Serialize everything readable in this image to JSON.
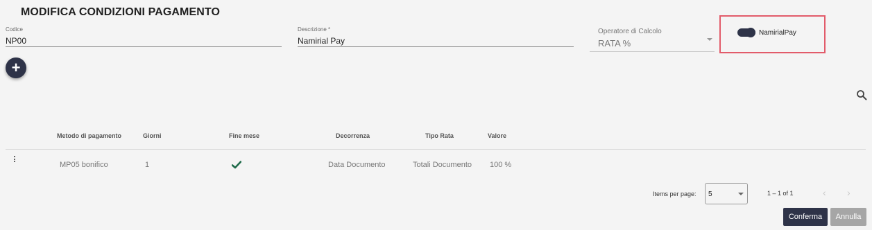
{
  "page": {
    "title": "MODIFICA CONDIZIONI PAGAMENTO"
  },
  "form": {
    "codice": {
      "label": "Codice",
      "value": "NP00"
    },
    "descrizione": {
      "label": "Descrizione *",
      "value": "Namirial Pay"
    },
    "operatore": {
      "label": "Operatore di Calcolo",
      "value": "RATA %"
    },
    "toggle": {
      "label": "NamirialPay",
      "checked": true
    }
  },
  "add_button": {
    "icon": "plus-icon",
    "glyph": "+"
  },
  "search": {
    "icon": "search-icon"
  },
  "table": {
    "headers": [
      "Metodo di pagamento",
      "Giorni",
      "Fine mese",
      "Decorrenza",
      "Tipo Rata",
      "Valore"
    ],
    "rows": [
      {
        "metodo": "MP05 bonifico",
        "giorni": "1",
        "fine_mese": true,
        "decorrenza": "Data Documento",
        "tipo_rata": "Totali Documento",
        "valore": "100 %"
      }
    ]
  },
  "pagination": {
    "items_per_page_label": "Items per page:",
    "items_per_page_value": "5",
    "range": "1 – 1 of 1",
    "prev": "‹",
    "next": "›"
  },
  "actions": {
    "confirm": "Conferma",
    "cancel": "Annulla"
  },
  "colors": {
    "primary": "#2e3348",
    "highlight_border": "#e25b6a",
    "check": "#1f6b4a"
  }
}
